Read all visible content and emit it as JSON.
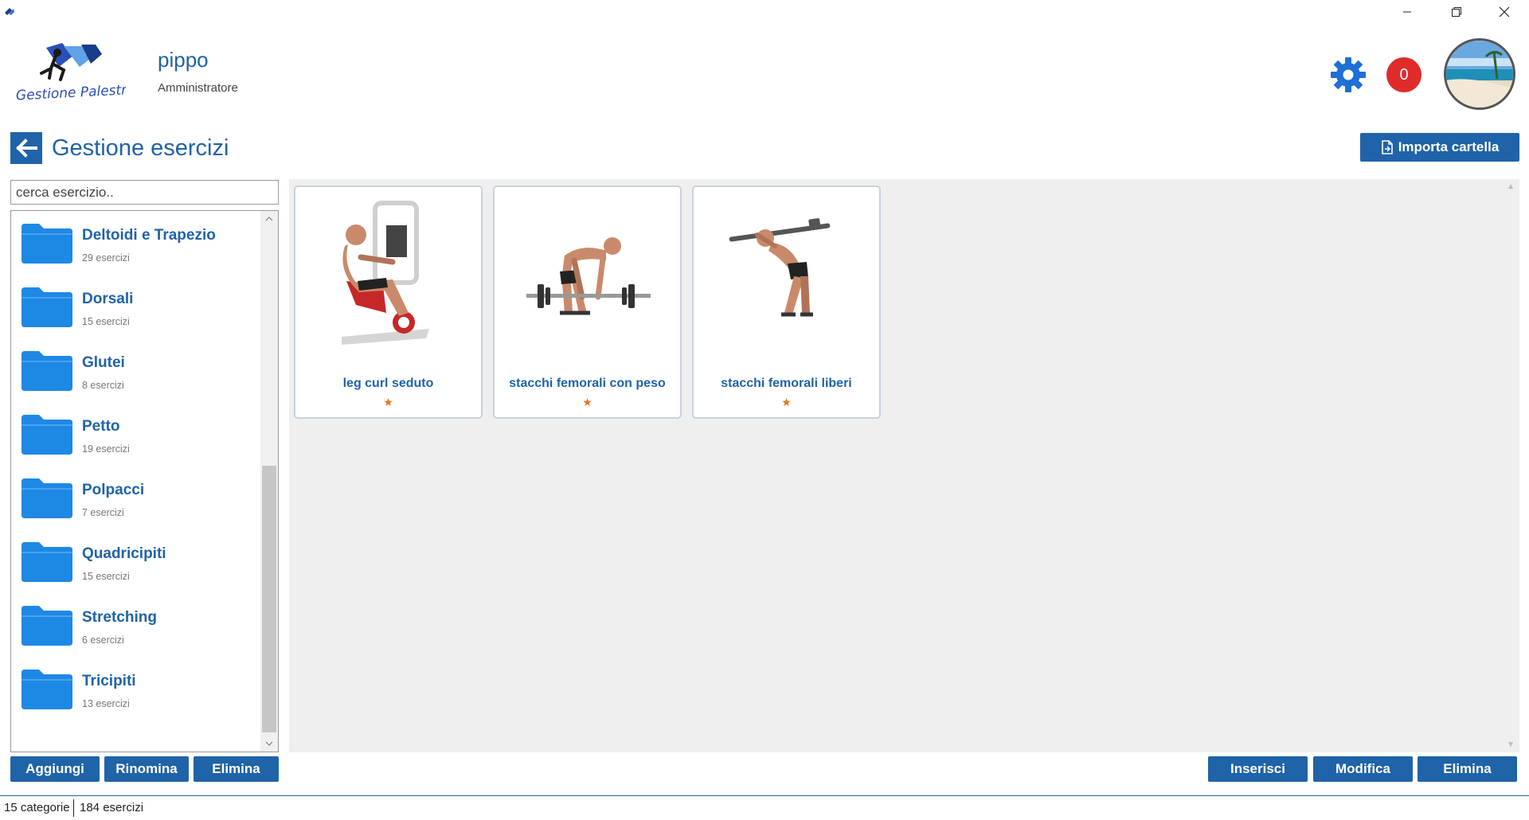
{
  "window": {
    "controls": [
      "minimize-icon",
      "restore-icon",
      "close-icon"
    ]
  },
  "header": {
    "logo_text": "Gestione Palestra",
    "user_name": "pippo",
    "user_role": "Amministratore",
    "notification_count": "0",
    "settings_icon": "gear-icon"
  },
  "page": {
    "title": "Gestione esercizi",
    "import_label": "Importa cartella"
  },
  "search": {
    "placeholder": "cerca esercizio.."
  },
  "categories": [
    {
      "name": "Deltoidi e Trapezio",
      "count": "29 esercizi"
    },
    {
      "name": "Dorsali",
      "count": "15 esercizi"
    },
    {
      "name": "Glutei",
      "count": "8 esercizi"
    },
    {
      "name": "Petto",
      "count": "19 esercizi"
    },
    {
      "name": "Polpacci",
      "count": "7 esercizi"
    },
    {
      "name": "Quadricipiti",
      "count": "15 esercizi"
    },
    {
      "name": "Stretching",
      "count": "6 esercizi"
    },
    {
      "name": "Tricipiti",
      "count": "13 esercizi"
    }
  ],
  "exercises": [
    {
      "name": "leg curl seduto",
      "star": "★"
    },
    {
      "name": "stacchi femorali con peso",
      "star": "★"
    },
    {
      "name": "stacchi femorali liberi",
      "star": "★"
    }
  ],
  "left_buttons": {
    "add": "Aggiungi",
    "rename": "Rinomina",
    "delete": "Elimina"
  },
  "right_buttons": {
    "insert": "Inserisci",
    "edit": "Modifica",
    "delete": "Elimina"
  },
  "status": {
    "categories": "15 categorie",
    "exercises": "184 esercizi"
  },
  "colors": {
    "accent": "#1f63a8",
    "badge": "#e02b2b",
    "folder": "#1e88e5",
    "star": "#e8731a"
  }
}
